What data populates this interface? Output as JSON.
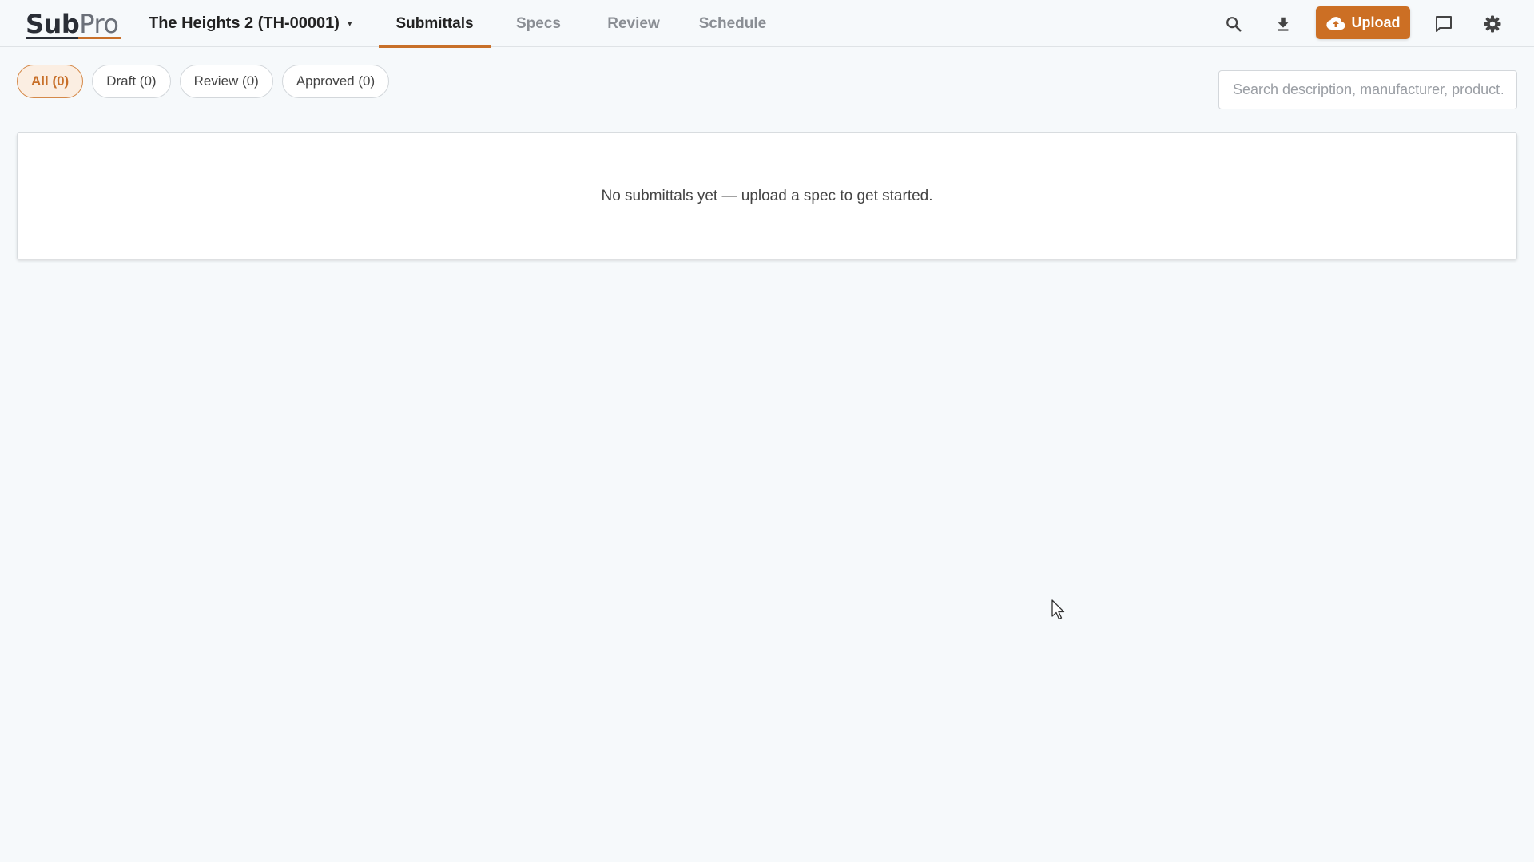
{
  "app": {
    "logo_main": "Sub",
    "logo_accent": "Pro"
  },
  "project": {
    "name": "The Heights 2 (TH-00001)",
    "caret": "▾"
  },
  "tabs": [
    {
      "label": "Submittals",
      "active": true
    },
    {
      "label": "Specs",
      "active": false
    },
    {
      "label": "Review",
      "active": false
    },
    {
      "label": "Schedule",
      "active": false
    }
  ],
  "toolbar": {
    "icons": [
      "search-icon",
      "download-icon",
      "chat-icon",
      "gear-icon"
    ],
    "upload_label": "Upload",
    "upload_icon": "cloud-upload-icon"
  },
  "filters": [
    {
      "label": "All (0)",
      "active": true
    },
    {
      "label": "Draft (0)",
      "active": false
    },
    {
      "label": "Review (0)",
      "active": false
    },
    {
      "label": "Approved (0)",
      "active": false
    }
  ],
  "search": {
    "placeholder": "Search description, manufacturer, product…",
    "value": ""
  },
  "empty_state": {
    "message": "No submittals yet — upload a spec to get started."
  },
  "colors": {
    "accent": "#cc6f24",
    "background": "#f6f9fb",
    "active_pill_bg": "#fbeee2"
  }
}
